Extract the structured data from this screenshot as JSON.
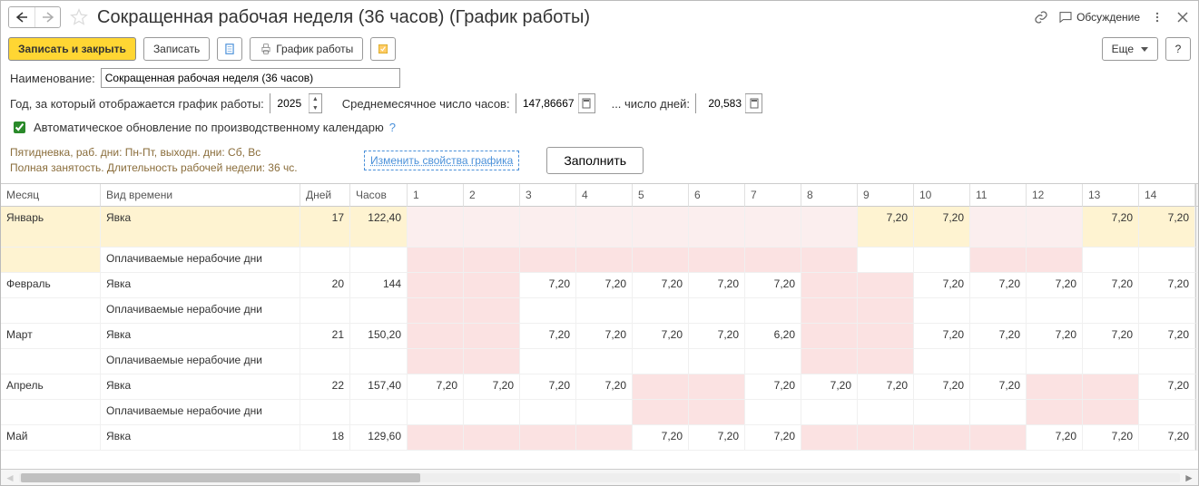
{
  "header": {
    "title": "Сокращенная рабочая неделя (36 часов) (График работы)",
    "discuss_label": "Обсуждение"
  },
  "toolbar": {
    "save_close": "Записать и закрыть",
    "save": "Записать",
    "print_schedule": "График работы",
    "more": "Еще",
    "help": "?"
  },
  "form": {
    "name_label": "Наименование:",
    "name_value": "Сокращенная рабочая неделя (36 часов)",
    "year_label": "Год, за который отображается график работы:",
    "year_value": "2025",
    "avg_month_hours_label": "Среднемесячное число часов:",
    "avg_month_hours_value": "147,86667",
    "avg_days_label": "... число дней:",
    "avg_days_value": "20,583",
    "auto_update_label": "Автоматическое обновление по производственному календарю",
    "desc_line1": "Пятидневка, раб. дни: Пн-Пт, выходн. дни: Сб, Вс",
    "desc_line2": "Полная занятость. Длительность рабочей недели: 36 чс.",
    "change_props": "Изменить свойства графика",
    "fill": "Заполнить"
  },
  "table": {
    "headers": {
      "month": "Месяц",
      "time_type": "Вид времени",
      "days": "Дней",
      "hours": "Часов"
    },
    "day_cols": [
      "1",
      "2",
      "3",
      "4",
      "5",
      "6",
      "7",
      "8",
      "9",
      "10",
      "11",
      "12",
      "13",
      "14"
    ],
    "time_types": {
      "work": "Явка",
      "paid_off": "Оплачиваемые нерабочие дни"
    },
    "months": [
      {
        "name": "Январь",
        "highlight": true,
        "rows": [
          {
            "type": "work",
            "days": "17",
            "hours": "122,40",
            "cells": [
              {
                "v": "",
                "c": "ypink"
              },
              {
                "v": "",
                "c": "ypink"
              },
              {
                "v": "",
                "c": "ypink"
              },
              {
                "v": "",
                "c": "ypink"
              },
              {
                "v": "",
                "c": "ypink"
              },
              {
                "v": "",
                "c": "ypink"
              },
              {
                "v": "",
                "c": "ypink"
              },
              {
                "v": "",
                "c": "ypink"
              },
              {
                "v": "7,20",
                "c": "yellow"
              },
              {
                "v": "7,20",
                "c": "yellow"
              },
              {
                "v": "",
                "c": "ypink"
              },
              {
                "v": "",
                "c": "ypink"
              },
              {
                "v": "7,20",
                "c": "yellow"
              },
              {
                "v": "7,20",
                "c": "yellow"
              }
            ]
          },
          {
            "type": "paid_off",
            "days": "",
            "hours": "",
            "cells": [
              {
                "v": "",
                "c": "pink"
              },
              {
                "v": "",
                "c": "pink"
              },
              {
                "v": "",
                "c": "pink"
              },
              {
                "v": "",
                "c": "pink"
              },
              {
                "v": "",
                "c": "pink"
              },
              {
                "v": "",
                "c": "pink"
              },
              {
                "v": "",
                "c": "pink"
              },
              {
                "v": "",
                "c": "pink"
              },
              {
                "v": "",
                "c": ""
              },
              {
                "v": "",
                "c": ""
              },
              {
                "v": "",
                "c": "pink"
              },
              {
                "v": "",
                "c": "pink"
              },
              {
                "v": "",
                "c": ""
              },
              {
                "v": "",
                "c": ""
              }
            ]
          }
        ]
      },
      {
        "name": "Февраль",
        "rows": [
          {
            "type": "work",
            "days": "20",
            "hours": "144",
            "cells": [
              {
                "v": "",
                "c": "pink"
              },
              {
                "v": "",
                "c": "pink"
              },
              {
                "v": "7,20",
                "c": ""
              },
              {
                "v": "7,20",
                "c": ""
              },
              {
                "v": "7,20",
                "c": ""
              },
              {
                "v": "7,20",
                "c": ""
              },
              {
                "v": "7,20",
                "c": ""
              },
              {
                "v": "",
                "c": "pink"
              },
              {
                "v": "",
                "c": "pink"
              },
              {
                "v": "7,20",
                "c": ""
              },
              {
                "v": "7,20",
                "c": ""
              },
              {
                "v": "7,20",
                "c": ""
              },
              {
                "v": "7,20",
                "c": ""
              },
              {
                "v": "7,20",
                "c": ""
              }
            ]
          },
          {
            "type": "paid_off",
            "days": "",
            "hours": "",
            "cells": [
              {
                "v": "",
                "c": "pink"
              },
              {
                "v": "",
                "c": "pink"
              },
              {
                "v": "",
                "c": ""
              },
              {
                "v": "",
                "c": ""
              },
              {
                "v": "",
                "c": ""
              },
              {
                "v": "",
                "c": ""
              },
              {
                "v": "",
                "c": ""
              },
              {
                "v": "",
                "c": "pink"
              },
              {
                "v": "",
                "c": "pink"
              },
              {
                "v": "",
                "c": ""
              },
              {
                "v": "",
                "c": ""
              },
              {
                "v": "",
                "c": ""
              },
              {
                "v": "",
                "c": ""
              },
              {
                "v": "",
                "c": ""
              }
            ]
          }
        ]
      },
      {
        "name": "Март",
        "rows": [
          {
            "type": "work",
            "days": "21",
            "hours": "150,20",
            "cells": [
              {
                "v": "",
                "c": "pink"
              },
              {
                "v": "",
                "c": "pink"
              },
              {
                "v": "7,20",
                "c": ""
              },
              {
                "v": "7,20",
                "c": ""
              },
              {
                "v": "7,20",
                "c": ""
              },
              {
                "v": "7,20",
                "c": ""
              },
              {
                "v": "6,20",
                "c": ""
              },
              {
                "v": "",
                "c": "pink"
              },
              {
                "v": "",
                "c": "pink"
              },
              {
                "v": "7,20",
                "c": ""
              },
              {
                "v": "7,20",
                "c": ""
              },
              {
                "v": "7,20",
                "c": ""
              },
              {
                "v": "7,20",
                "c": ""
              },
              {
                "v": "7,20",
                "c": ""
              }
            ]
          },
          {
            "type": "paid_off",
            "days": "",
            "hours": "",
            "cells": [
              {
                "v": "",
                "c": "pink"
              },
              {
                "v": "",
                "c": "pink"
              },
              {
                "v": "",
                "c": ""
              },
              {
                "v": "",
                "c": ""
              },
              {
                "v": "",
                "c": ""
              },
              {
                "v": "",
                "c": ""
              },
              {
                "v": "",
                "c": ""
              },
              {
                "v": "",
                "c": "pink"
              },
              {
                "v": "",
                "c": "pink"
              },
              {
                "v": "",
                "c": ""
              },
              {
                "v": "",
                "c": ""
              },
              {
                "v": "",
                "c": ""
              },
              {
                "v": "",
                "c": ""
              },
              {
                "v": "",
                "c": ""
              }
            ]
          }
        ]
      },
      {
        "name": "Апрель",
        "rows": [
          {
            "type": "work",
            "days": "22",
            "hours": "157,40",
            "cells": [
              {
                "v": "7,20",
                "c": ""
              },
              {
                "v": "7,20",
                "c": ""
              },
              {
                "v": "7,20",
                "c": ""
              },
              {
                "v": "7,20",
                "c": ""
              },
              {
                "v": "",
                "c": "pink"
              },
              {
                "v": "",
                "c": "pink"
              },
              {
                "v": "7,20",
                "c": ""
              },
              {
                "v": "7,20",
                "c": ""
              },
              {
                "v": "7,20",
                "c": ""
              },
              {
                "v": "7,20",
                "c": ""
              },
              {
                "v": "7,20",
                "c": ""
              },
              {
                "v": "",
                "c": "pink"
              },
              {
                "v": "",
                "c": "pink"
              },
              {
                "v": "7,20",
                "c": ""
              }
            ]
          },
          {
            "type": "paid_off",
            "days": "",
            "hours": "",
            "cells": [
              {
                "v": "",
                "c": ""
              },
              {
                "v": "",
                "c": ""
              },
              {
                "v": "",
                "c": ""
              },
              {
                "v": "",
                "c": ""
              },
              {
                "v": "",
                "c": "pink"
              },
              {
                "v": "",
                "c": "pink"
              },
              {
                "v": "",
                "c": ""
              },
              {
                "v": "",
                "c": ""
              },
              {
                "v": "",
                "c": ""
              },
              {
                "v": "",
                "c": ""
              },
              {
                "v": "",
                "c": ""
              },
              {
                "v": "",
                "c": "pink"
              },
              {
                "v": "",
                "c": "pink"
              },
              {
                "v": "",
                "c": ""
              }
            ]
          }
        ]
      },
      {
        "name": "Май",
        "rows": [
          {
            "type": "work",
            "days": "18",
            "hours": "129,60",
            "cells": [
              {
                "v": "",
                "c": "pink"
              },
              {
                "v": "",
                "c": "pink"
              },
              {
                "v": "",
                "c": "pink"
              },
              {
                "v": "",
                "c": "pink"
              },
              {
                "v": "7,20",
                "c": ""
              },
              {
                "v": "7,20",
                "c": ""
              },
              {
                "v": "7,20",
                "c": ""
              },
              {
                "v": "",
                "c": "pink"
              },
              {
                "v": "",
                "c": "pink"
              },
              {
                "v": "",
                "c": "pink"
              },
              {
                "v": "",
                "c": "pink"
              },
              {
                "v": "7,20",
                "c": ""
              },
              {
                "v": "7,20",
                "c": ""
              },
              {
                "v": "7,20",
                "c": ""
              }
            ]
          }
        ]
      }
    ]
  }
}
